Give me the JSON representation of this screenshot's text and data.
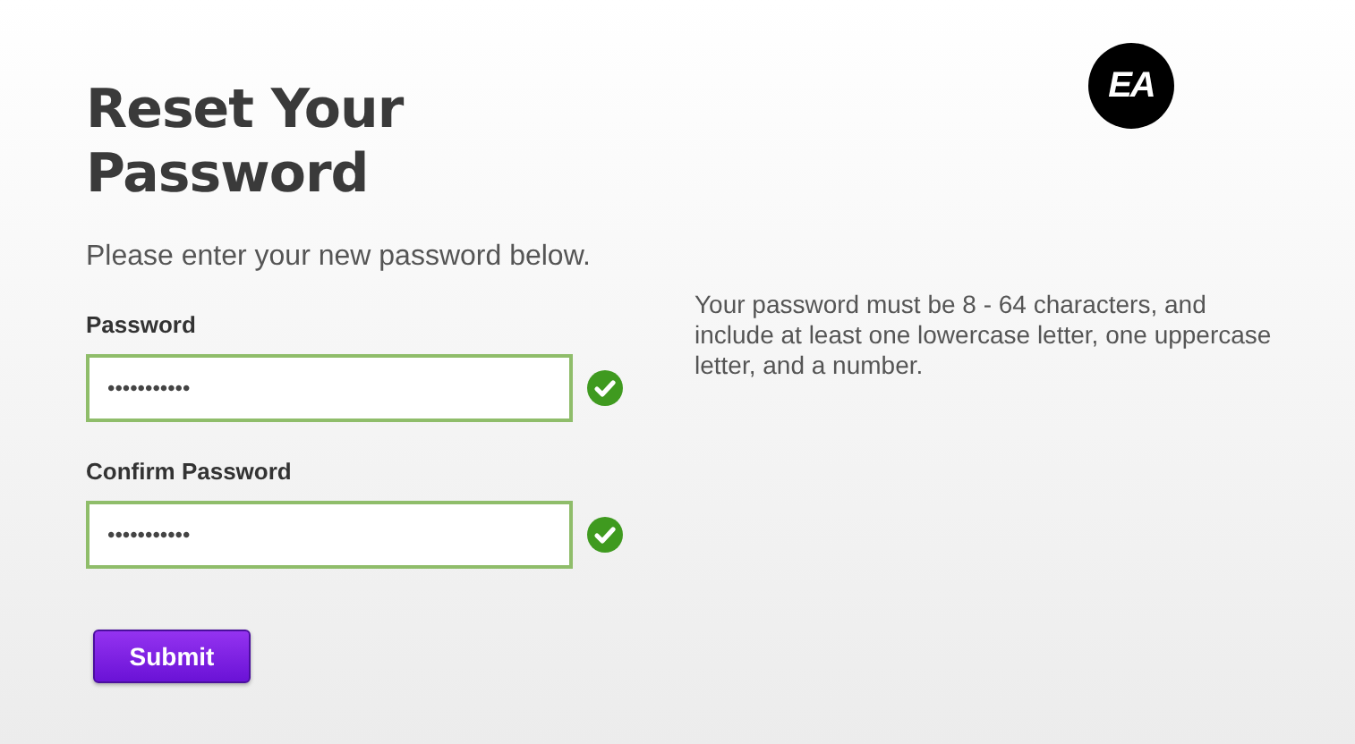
{
  "title": "Reset Your Password",
  "subtitle": "Please enter your new password below.",
  "fields": [
    {
      "label": "Password",
      "value": "•••••••••••",
      "valid": true
    },
    {
      "label": "Confirm Password",
      "value": "•••••••••••",
      "valid": true
    }
  ],
  "submit": "Submit",
  "logo": "EA",
  "hint": "Your password must be 8 - 64 characters, and include at least one lowercase letter, one uppercase letter, and a number."
}
